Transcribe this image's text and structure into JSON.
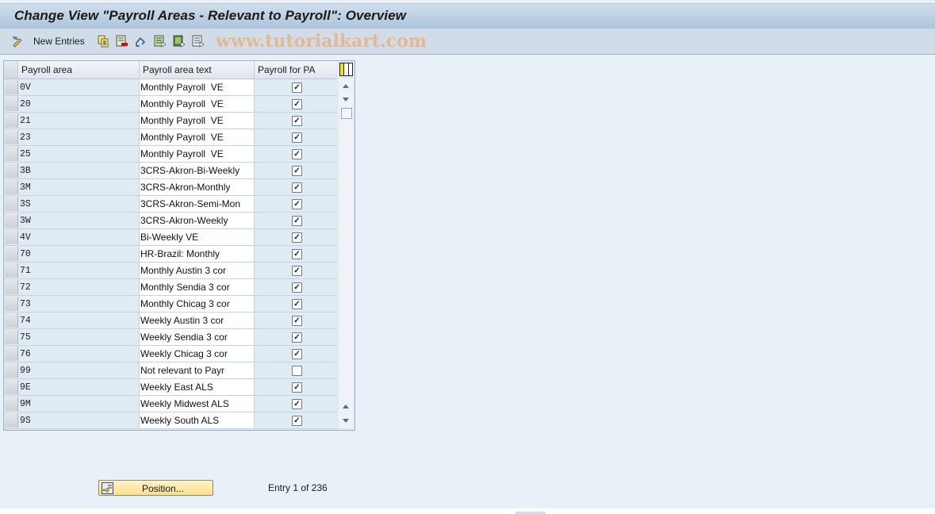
{
  "window": {
    "title": "Change View \"Payroll Areas - Relevant to Payroll\": Overview"
  },
  "toolbar": {
    "new_entries_label": "New Entries",
    "icons": [
      "display-change-icon",
      "copy-as-icon",
      "delete-icon",
      "undo-change-icon",
      "select-all-icon",
      "select-block-icon",
      "deselect-all-icon"
    ],
    "watermark": "www.tutorialkart.com"
  },
  "table": {
    "columns": [
      "Payroll area",
      "Payroll area text",
      "Payroll for PA"
    ],
    "rows": [
      {
        "area": "0V",
        "text": "Monthly Payroll  VE",
        "checked": true
      },
      {
        "area": "20",
        "text": "Monthly Payroll  VE",
        "checked": true
      },
      {
        "area": "21",
        "text": "Monthly Payroll  VE",
        "checked": true
      },
      {
        "area": "23",
        "text": "Monthly Payroll  VE",
        "checked": true
      },
      {
        "area": "25",
        "text": "Monthly Payroll  VE",
        "checked": true
      },
      {
        "area": "3B",
        "text": "3CRS-Akron-Bi-Weekly",
        "checked": true
      },
      {
        "area": "3M",
        "text": "3CRS-Akron-Monthly",
        "checked": true
      },
      {
        "area": "3S",
        "text": "3CRS-Akron-Semi-Mon",
        "checked": true
      },
      {
        "area": "3W",
        "text": "3CRS-Akron-Weekly",
        "checked": true
      },
      {
        "area": "4V",
        "text": "Bi-Weekly VE",
        "checked": true
      },
      {
        "area": "70",
        "text": "HR-Brazil: Monthly",
        "checked": true
      },
      {
        "area": "71",
        "text": "Monthly Austin 3 cor",
        "checked": true
      },
      {
        "area": "72",
        "text": "Monthly Sendia 3 cor",
        "checked": true
      },
      {
        "area": "73",
        "text": "Monthly Chicag 3 cor",
        "checked": true
      },
      {
        "area": "74",
        "text": "Weekly Austin 3 cor",
        "checked": true
      },
      {
        "area": "75",
        "text": "Weekly Sendia 3 cor",
        "checked": true
      },
      {
        "area": "76",
        "text": "Weekly Chicag 3 cor",
        "checked": true
      },
      {
        "area": "99",
        "text": "Not relevant to Payr",
        "checked": false
      },
      {
        "area": "9E",
        "text": "Weekly East ALS",
        "checked": true
      },
      {
        "area": "9M",
        "text": "Weekly Midwest ALS",
        "checked": true
      },
      {
        "area": "9S",
        "text": "Weekly South ALS",
        "checked": true
      }
    ]
  },
  "footer": {
    "position_button_label": "Position...",
    "entry_info": "Entry 1 of 236"
  }
}
